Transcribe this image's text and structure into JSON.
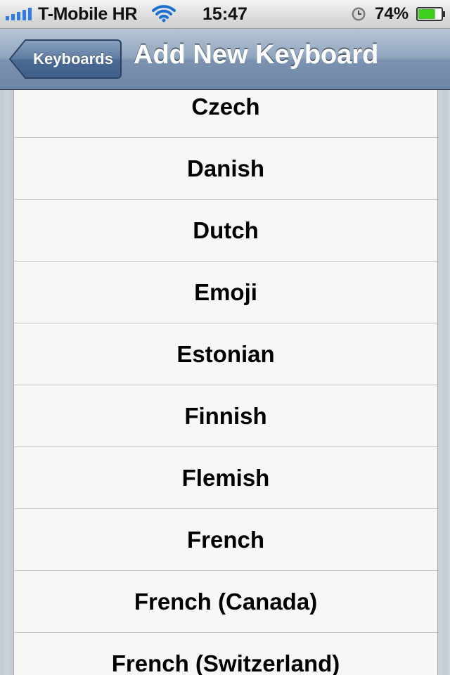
{
  "status_bar": {
    "carrier": "T-Mobile HR",
    "time": "15:47",
    "battery_percent": "74%",
    "icons": [
      "signal-bars-icon",
      "wifi-icon",
      "alarm-clock-icon",
      "battery-icon"
    ],
    "signal_bars": 5,
    "battery_level": 0.74,
    "battery_color": "#3fcf1f",
    "wifi_color": "#1f6fcf"
  },
  "nav_bar": {
    "back_label": "Keyboards",
    "title": "Add New Keyboard",
    "tint": "#6d86a5"
  },
  "keyboards": {
    "items": [
      "Czech",
      "Danish",
      "Dutch",
      "Emoji",
      "Estonian",
      "Finnish",
      "Flemish",
      "French",
      "French (Canada)",
      "French (Switzerland)"
    ]
  }
}
